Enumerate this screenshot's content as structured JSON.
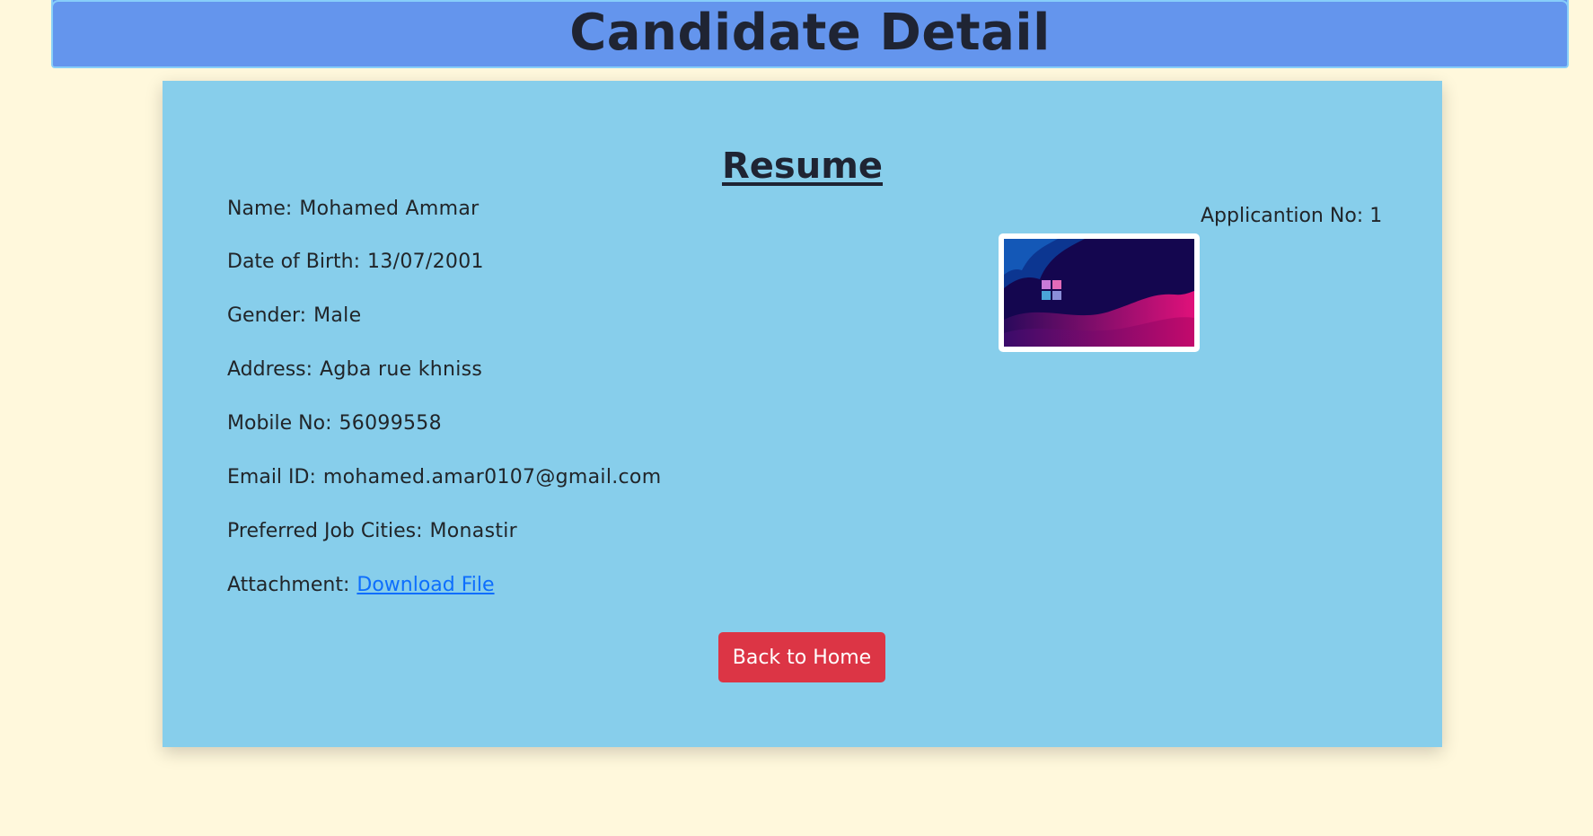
{
  "header": {
    "title": "Candidate Detail"
  },
  "resume": {
    "title": "Resume",
    "application": {
      "label": "Applicantion No:",
      "value": "1"
    },
    "photo": {
      "icon": "windows-logo-wallpaper"
    },
    "fields": {
      "name": {
        "label": "Name:",
        "value": "Mohamed Ammar"
      },
      "dob": {
        "label": "Date of Birth:",
        "value": "13/07/2001"
      },
      "gender": {
        "label": "Gender:",
        "value": "Male"
      },
      "address": {
        "label": "Address:",
        "value": "Agba rue khniss"
      },
      "mobile": {
        "label": "Mobile No:",
        "value": "56099558"
      },
      "email": {
        "label": "Email ID:",
        "value": "mohamed.amar0107@gmail.com"
      },
      "cities": {
        "label": "Preferred Job Cities:",
        "value": "Monastir"
      },
      "attachment": {
        "label": "Attachment:",
        "link": "Download File"
      }
    },
    "back_button": "Back to Home"
  },
  "colors": {
    "page_bg": "#fff8dc",
    "header_bg": "#6495ed",
    "card_bg": "#87ceeb",
    "button_bg": "#dc3545",
    "link": "#0d6efd"
  }
}
